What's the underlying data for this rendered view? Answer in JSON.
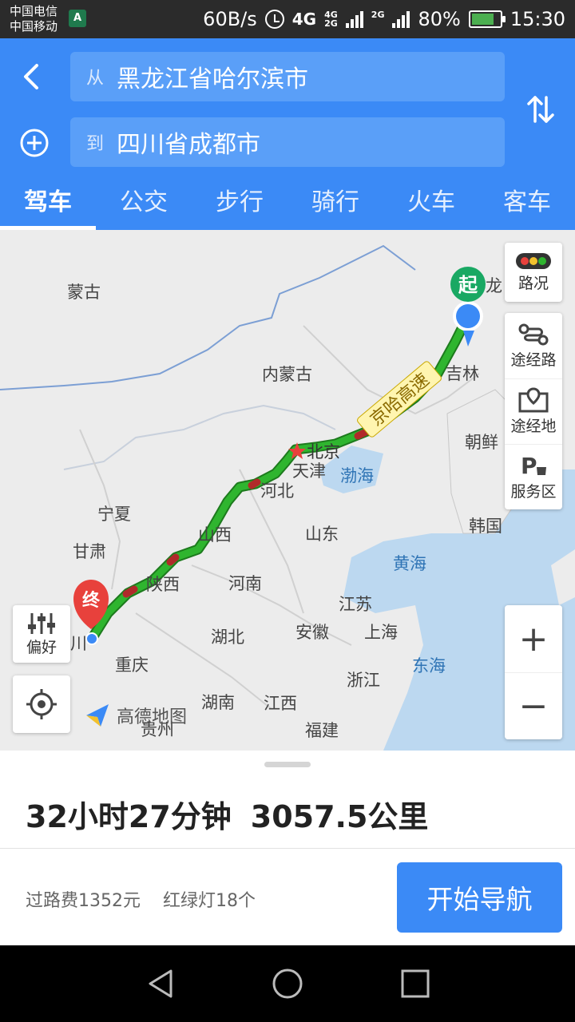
{
  "status_bar": {
    "carrier_1": "中国电信",
    "carrier_2": "中国移动",
    "sim_badge": "A",
    "speed": "60B/s",
    "network": "4G",
    "sig_4g_top": "4G",
    "sig_4g_bottom": "2G",
    "sig_2g": "2G",
    "battery": "80%",
    "battery_level": 0.8,
    "time": "15:30",
    "battery_color": "#4caf50"
  },
  "route": {
    "from_prefix": "从",
    "from_value": "黑龙江省哈尔滨市",
    "to_prefix": "到",
    "to_value": "四川省成都市"
  },
  "tabs": [
    {
      "label": "驾车",
      "active": true
    },
    {
      "label": "公交",
      "active": false
    },
    {
      "label": "步行",
      "active": false
    },
    {
      "label": "骑行",
      "active": false
    },
    {
      "label": "火车",
      "active": false
    },
    {
      "label": "客车",
      "active": false
    }
  ],
  "map": {
    "start_marker": "起",
    "end_marker": "终",
    "highway_label": "京哈高速",
    "labels": {
      "mongolia": "蒙古",
      "inner_mongolia": "内蒙古",
      "heilongjiang_partial": "龙",
      "jilin": "吉林",
      "korea_north": "朝鲜",
      "korea_south": "韩国",
      "beijing": "北京",
      "tianjin": "天津",
      "hebei": "河北",
      "bohai": "渤海",
      "ningxia": "宁夏",
      "gansu": "甘肃",
      "shanxi": "山西",
      "shandong": "山东",
      "yellow_sea": "黄海",
      "shaanxi": "陕西",
      "henan": "河南",
      "jiangsu": "江苏",
      "anhui": "安徽",
      "shanghai": "上海",
      "hubei": "湖北",
      "sichuan_partial": "川",
      "chongqing": "重庆",
      "east_sea": "东海",
      "zhejiang": "浙江",
      "hunan": "湖南",
      "jiangxi": "江西",
      "guizhou": "贵州",
      "fujian": "福建"
    },
    "controls": {
      "traffic": "路况",
      "via_road": "途经路",
      "via_place": "途经地",
      "service_area": "服务区",
      "zoom_in": "+",
      "zoom_out": "−",
      "preference": "偏好"
    },
    "logo": "高德地图",
    "colors": {
      "route": "#2fb52f",
      "congestion": "#b02a2a",
      "start": "#19a863",
      "end": "#e8413c",
      "water": "#bcd8f0",
      "land": "#ececec"
    }
  },
  "summary": {
    "duration": "32小时27分钟",
    "distance": "3057.5公里",
    "toll": "过路费1352元",
    "traffic_lights": "红绿灯18个",
    "start_button": "开始导航"
  }
}
